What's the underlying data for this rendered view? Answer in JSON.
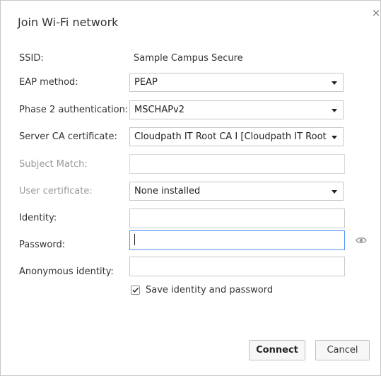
{
  "dialog": {
    "title": "Join Wi-Fi network",
    "close_symbol": "×"
  },
  "fields": {
    "ssid": {
      "label": "SSID:",
      "value": "Sample Campus Secure"
    },
    "eap_method": {
      "label": "EAP method:",
      "value": "PEAP"
    },
    "phase2": {
      "label": "Phase 2 authentication:",
      "value": "MSCHAPv2"
    },
    "server_ca": {
      "label": "Server CA certificate:",
      "value": "Cloudpath IT Root CA I [Cloudpath IT Root CA I]"
    },
    "subject_match": {
      "label": "Subject Match:",
      "value": ""
    },
    "user_cert": {
      "label": "User certificate:",
      "value": "None installed"
    },
    "identity": {
      "label": "Identity:",
      "value": ""
    },
    "password": {
      "label": "Password:",
      "value": ""
    },
    "anonymous_identity": {
      "label": "Anonymous identity:",
      "value": ""
    }
  },
  "save_checkbox": {
    "label": "Save identity and password",
    "checked": true
  },
  "buttons": {
    "connect": "Connect",
    "cancel": "Cancel"
  },
  "colors": {
    "focus_border": "#4d90fe",
    "disabled_label": "#999999"
  }
}
